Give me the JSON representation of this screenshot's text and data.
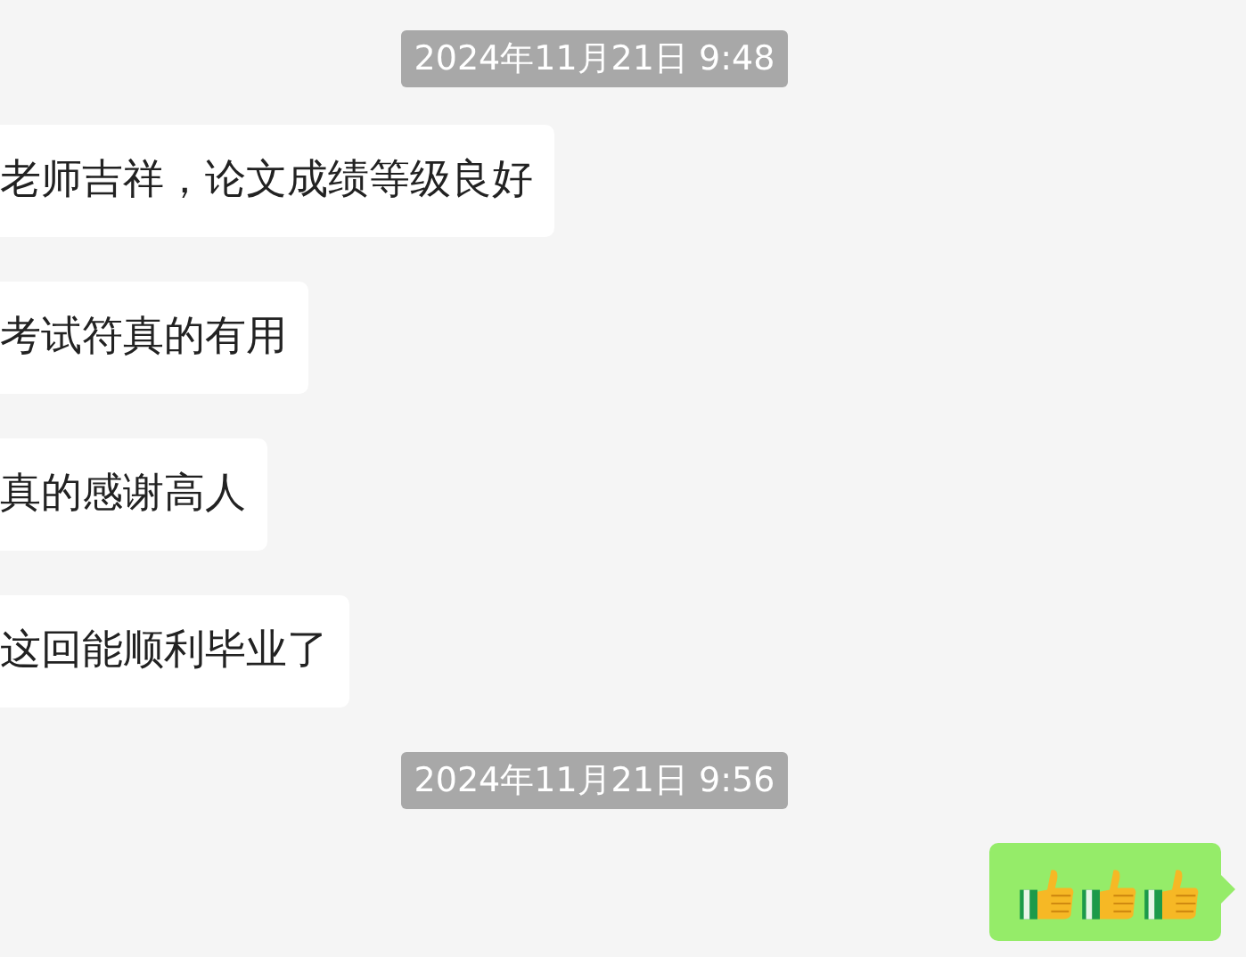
{
  "chat": [
    {
      "kind": "time",
      "text": "2024年11月21日 9:48"
    },
    {
      "kind": "incoming",
      "text": "老师吉祥，论文成绩等级良好"
    },
    {
      "kind": "incoming",
      "text": "考试符真的有用"
    },
    {
      "kind": "incoming",
      "text": "真的感谢高人"
    },
    {
      "kind": "incoming",
      "text": "这回能顺利毕业了"
    },
    {
      "kind": "time",
      "text": "2024年11月21日 9:56"
    },
    {
      "kind": "outgoing",
      "icons": [
        {
          "kind": "thumbs-up"
        },
        {
          "kind": "thumbs-up"
        },
        {
          "kind": "thumbs-up"
        }
      ]
    }
  ]
}
